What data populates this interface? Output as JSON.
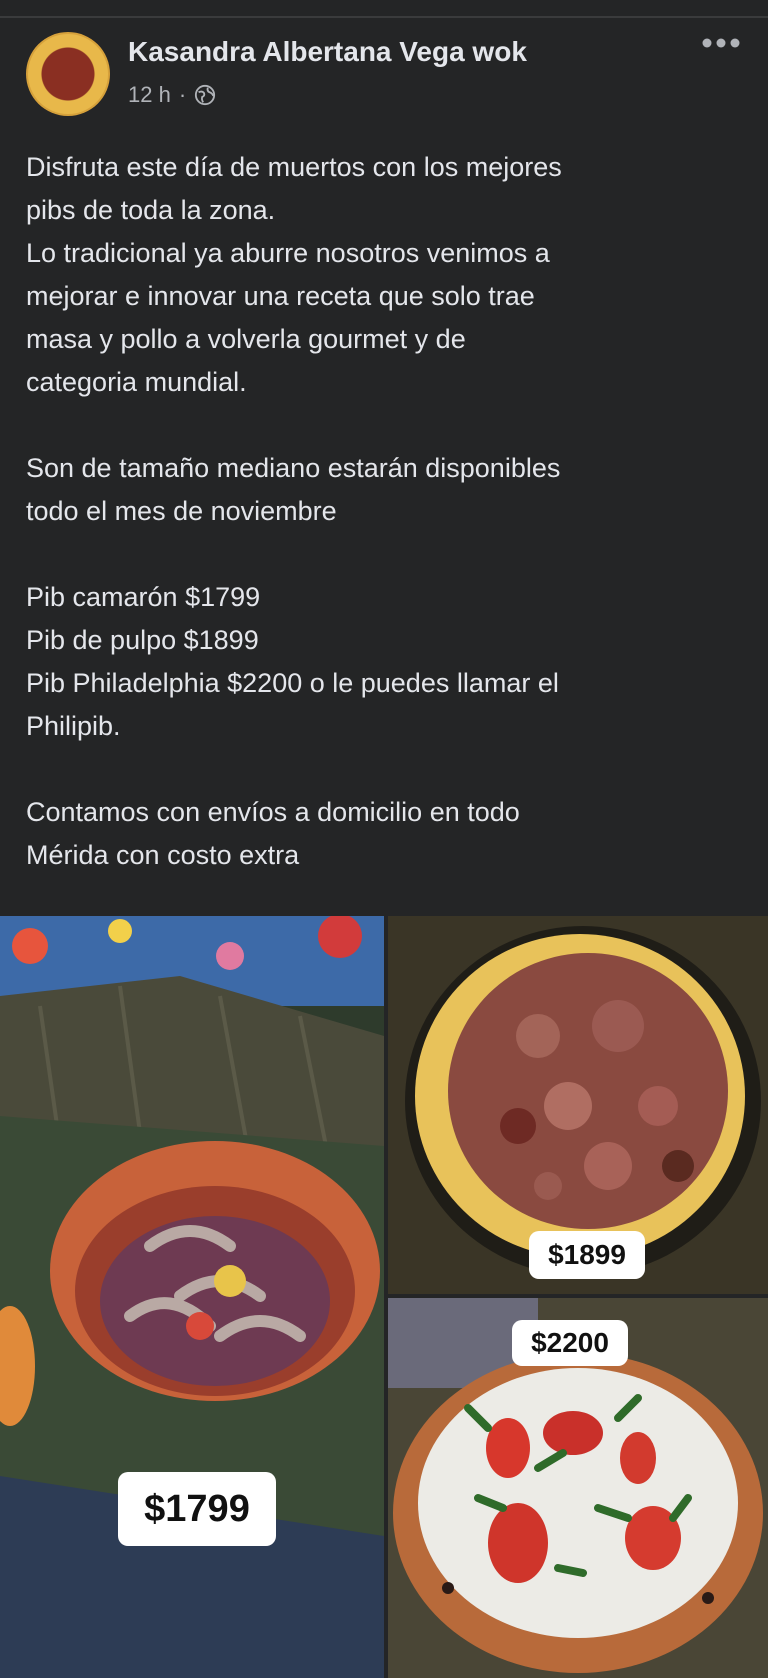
{
  "post": {
    "author": "Kasandra Albertana Vega wok",
    "time": "12 h",
    "separator": "·",
    "privacy_icon": "globe-icon",
    "more_icon": "more-options-icon",
    "body": "Disfruta este día de muertos con los mejores\npibs de toda la zona.\nLo tradicional ya aburre nosotros venimos a\nmejorar e innovar una receta que solo trae\nmasa y pollo a volverla gourmet y de\ncategoria mundial.\n\nSon de tamaño mediano estarán disponibles\ntodo el mes de noviembre\n\nPib camarón $1799\nPib de pulpo $1899\nPib Philadelphia $2200 o le puedes llamar el\nPhilipib.\n\nContamos con envíos a domicilio en todo\nMérida con costo extra"
  },
  "photos": [
    {
      "price": "$1799",
      "subject": "shrimp pib on banana leaves"
    },
    {
      "price": "$1899",
      "subject": "octopus pib"
    },
    {
      "price": "$2200",
      "subject": "philadelphia pib"
    }
  ],
  "colors": {
    "background": "#242526",
    "text": "#e4e6eb",
    "secondary_text": "#b0b3b8"
  }
}
